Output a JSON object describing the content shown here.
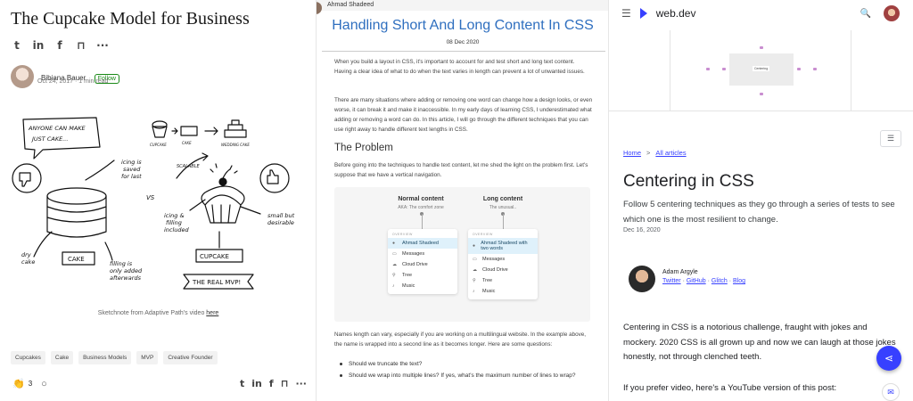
{
  "medium": {
    "title": "The Cupcake Model for Business",
    "share_icons": [
      "twitter-icon",
      "linkedin-icon",
      "facebook-icon",
      "bookmark-icon",
      "more-icon"
    ],
    "author": "Bibiana Bauer",
    "follow_label": "Follow",
    "date_read": "Oct 24, 2017 · 1 min read",
    "sketch": {
      "anyone_line1": "ANYONE CAN MAKE",
      "anyone_line2": "JUST CAKE...",
      "icing_saved_1": "icing is",
      "icing_saved_2": "saved",
      "icing_saved_3": "for last",
      "vs": "VS",
      "cupcake_small": "CUPCAKE",
      "cake_small": "CAKE",
      "wedding": "WEDDING CAKE",
      "scalable": "SCALABLE",
      "icing_filling_1": "icing &",
      "icing_filling_2": "filling",
      "icing_filling_3": "included",
      "small_1": "small but",
      "small_2": "desirable",
      "dry_1": "dry",
      "dry_2": "cake",
      "cake_label": "CAKE",
      "filling_1": "filling is",
      "filling_2": "only added",
      "filling_3": "afterwards",
      "cupcake_label": "CUPCAKE",
      "mvp": "THE REAL MVP!"
    },
    "caption_prefix": "Sketchnote from Adaptive Path's video ",
    "caption_link": "here",
    "tags": [
      "Cupcakes",
      "Cake",
      "Business Models",
      "MVP",
      "Creative Founder"
    ],
    "claps": "3"
  },
  "shadeed": {
    "author": "Ahmad Shadeed",
    "title": "Handling Short And Long Content In CSS",
    "date": "08 Dec 2020",
    "para1": "When you build a layout in CSS, it's important to account for and test short and long text content. Having a clear idea of what to do when the text varies in length can prevent a lot of unwanted issues.",
    "para2": "There are many situations where adding or removing one word can change how a design looks, or even worse, it can break it and make it inaccessible. In my early days of learning CSS, I underestimated what adding or removing a word can do. In this article, I will go through the different techniques that you can use right away to handle different text lengths in CSS.",
    "h2": "The Problem",
    "para3": "Before going into the techniques to handle text content, let me shed the light on the problem first. Let's suppose that we have a vertical navigation.",
    "figure": {
      "normal_title": "Normal content",
      "normal_sub": "AKA: The comfort zone",
      "long_title": "Long content",
      "long_sub": "The unusual..",
      "overview": "OVERVIEW",
      "normal_items": [
        "Ahmad Shadeed",
        "Messages",
        "Cloud Drive",
        "Tree",
        "Music"
      ],
      "long_items": [
        "Ahmad Shadeed with two words",
        "Messages",
        "Cloud Drive",
        "Tree",
        "Music"
      ]
    },
    "para4": "Names length can vary, especially if you are working on a multilingual website. In the example above, the name is wrapped into a second line as it becomes longer. Here are some questions:",
    "questions": [
      "Should we truncate the text?",
      "Should we wrap into multiple lines? If yes, what's the maximum number of lines to wrap?"
    ]
  },
  "webdev": {
    "brand": "web.dev",
    "demo_label": "Centering",
    "crumb_home": "Home",
    "crumb_sep": ">",
    "crumb_articles": "All articles",
    "title": "Centering in CSS",
    "subtitle": "Follow 5 centering techniques as they go through a series of tests to see which one is the most resilient to change.",
    "date": "Dec 16, 2020",
    "author_name": "Adam Argyle",
    "author_links": [
      "Twitter",
      "GitHub",
      "Glitch",
      "Blog"
    ],
    "body1": "Centering in CSS is a notorious challenge, fraught with jokes and mockery. 2020 CSS is all grown up and now we can laugh at those jokes honestly, not through clenched teeth.",
    "body2": "If you prefer video, here's a YouTube version of this post:",
    "accent": "#3740ff"
  }
}
